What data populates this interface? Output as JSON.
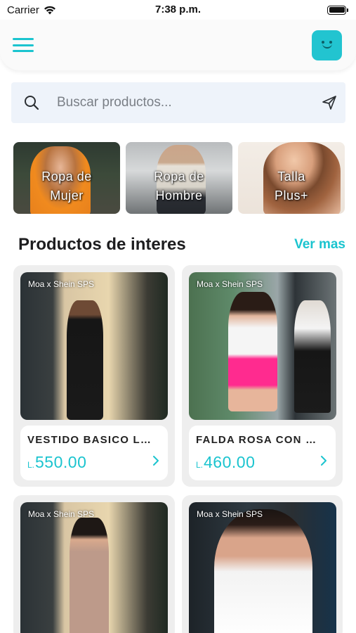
{
  "status_bar": {
    "carrier": "Carrier",
    "time": "7:38 p.m.",
    "wifi_icon": "wifi-icon",
    "battery_icon": "battery-icon"
  },
  "header": {
    "menu_icon": "hamburger-icon",
    "profile_icon": "smile-icon",
    "accent_color": "#1bc4cf"
  },
  "search": {
    "placeholder": "Buscar productos...",
    "value": "",
    "search_icon": "search-icon",
    "send_icon": "send-icon"
  },
  "categories": [
    {
      "label": "Ropa de\nMujer"
    },
    {
      "label": "Ropa de\nHombre"
    },
    {
      "label": "Talla\nPlus+"
    }
  ],
  "section": {
    "title": "Productos de interes",
    "see_more": "Ver mas"
  },
  "products": [
    {
      "brand": "Moa x Shein SPS",
      "name": "VESTIDO BASICO LA...",
      "currency": "L.",
      "price": "550.00"
    },
    {
      "brand": "Moa x Shein SPS",
      "name": "FALDA ROSA CON M...",
      "currency": "L.",
      "price": "460.00"
    },
    {
      "brand": "Moa x Shein SPS"
    },
    {
      "brand": "Moa x Shein SPS"
    }
  ]
}
